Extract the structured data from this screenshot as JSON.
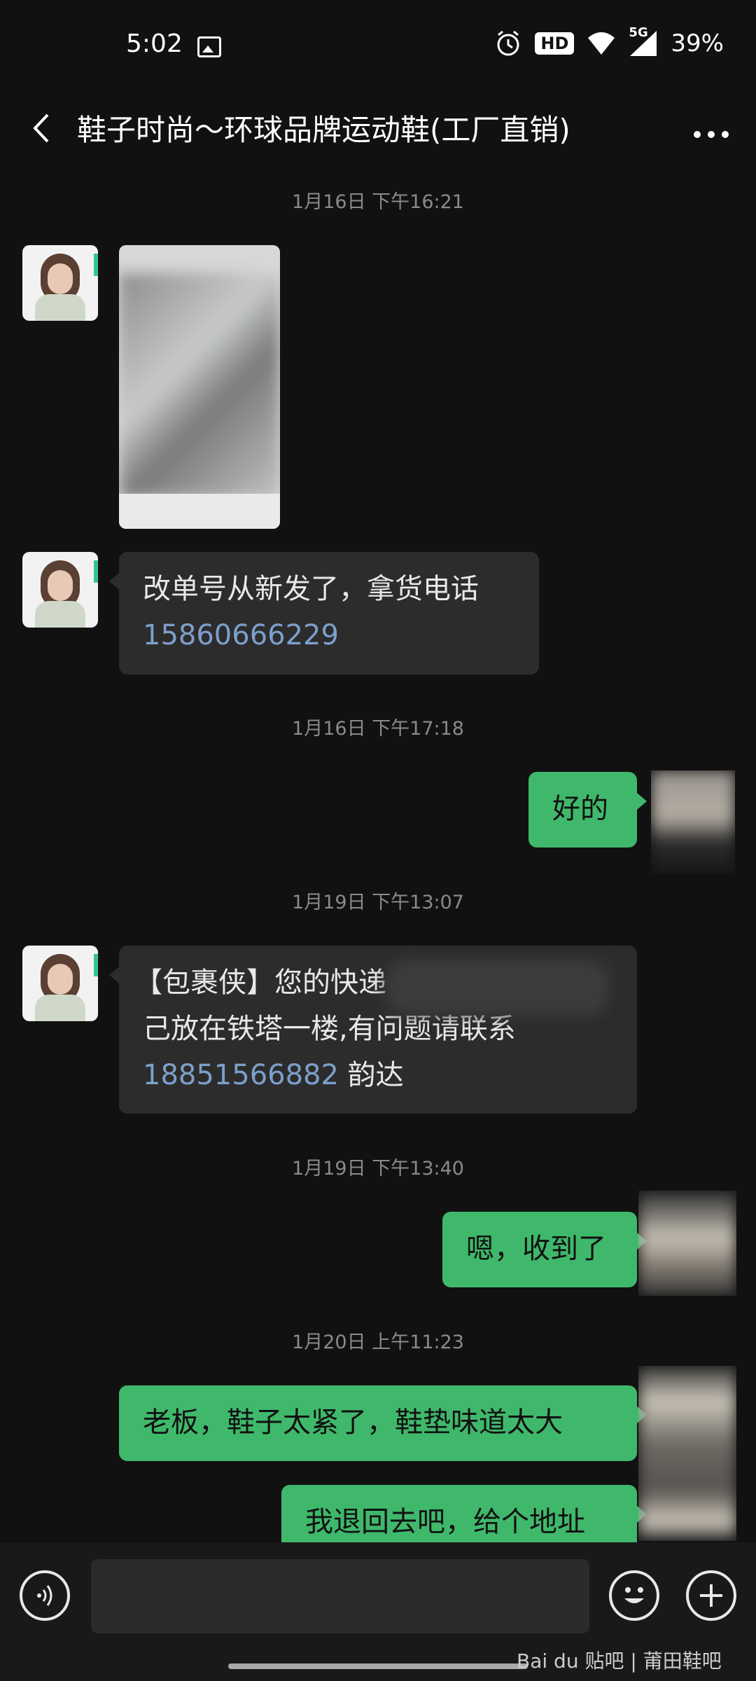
{
  "status_bar": {
    "time": "5:02",
    "hd": "HD",
    "net": "5G",
    "battery": "39%"
  },
  "header": {
    "title": "鞋子时尚～环球品牌运动鞋(工厂直销)"
  },
  "messages": {
    "t1": "1月16日 下午16:21",
    "m2_line1": "改单号从新发了，拿货电话",
    "m2_phone": "15860666229",
    "t2": "1月16日 下午17:18",
    "m3": "好的",
    "t3": "1月19日 下午13:07",
    "m4_line1": "【包裹侠】您的快递",
    "m4_line2": "己放在铁塔一楼,有问题请联系",
    "m4_phone": "18851566882",
    "m4_suffix": " 韵达",
    "t4": "1月19日 下午13:40",
    "m5": "嗯，收到了",
    "t5": "1月20日 上午11:23",
    "m6": "老板，鞋子太紧了，鞋垫味道太大",
    "m7": "我退回去吧，给个地址"
  },
  "watermark": {
    "text": "Bai du 贴吧 | 莆田鞋吧"
  },
  "icons": [
    "back-icon",
    "more-icon",
    "voice-icon",
    "emoji-icon",
    "add-icon",
    "alarm-icon",
    "wifi-icon",
    "signal-icon",
    "image-icon"
  ]
}
